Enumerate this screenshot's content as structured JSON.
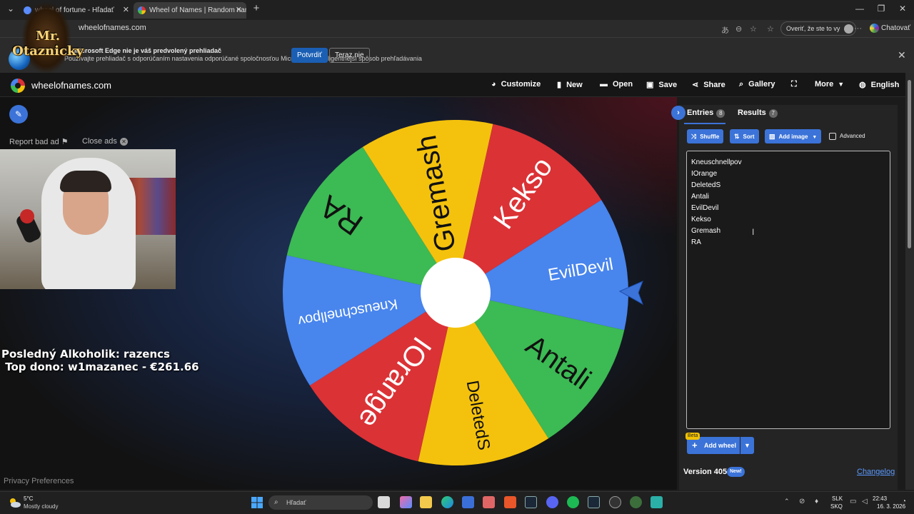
{
  "browser": {
    "tabs": [
      {
        "label": "wheel of fortune - Hľadať",
        "active": false
      },
      {
        "label": "Wheel of Names | Random name pi",
        "active": true
      }
    ],
    "new_tab": "+",
    "url": "wheelofnames.com",
    "verify_label": "Overiť, že ste to vy",
    "chat_label": "Chatovať"
  },
  "notification": {
    "title": "Microsoft Edge nie je váš predvolený prehliadač",
    "body": "Používajte prehliadač s odporúčaním nastavenia odporúčané spoločnosťou Microsoft na inteligentnejší spôsob prehľadávania",
    "confirm": "Potvrdiť",
    "not_now": "Teraz nie"
  },
  "overlay": {
    "logo_text": "Mr. Otaznicky",
    "line1": "Posledný Alkoholik: razencs",
    "line2": " Top dono: w1mazanec - €261.66"
  },
  "header": {
    "brand": "wheelofnames.com",
    "nav": [
      {
        "label": "Customize",
        "icon": "palette-icon"
      },
      {
        "label": "New",
        "icon": "file-icon"
      },
      {
        "label": "Open",
        "icon": "folder-icon"
      },
      {
        "label": "Save",
        "icon": "save-icon"
      },
      {
        "label": "Share",
        "icon": "share-icon"
      },
      {
        "label": "Gallery",
        "icon": "search-icon"
      },
      {
        "label": "",
        "icon": "fullscreen-icon"
      },
      {
        "label": "More",
        "icon": "chevron-down-icon"
      },
      {
        "label": "English",
        "icon": "globe-icon"
      }
    ]
  },
  "ads": {
    "report": "Report bad ad",
    "close": "Close ads",
    "privacy": "Privacy Preferences"
  },
  "wheel": {
    "colors": {
      "red": "#db3236",
      "blue": "#4885ed",
      "green": "#3cba54",
      "yellow": "#f4c20d"
    },
    "segments": [
      {
        "label": "EvilDevil",
        "color": "#4885ed"
      },
      {
        "label": "Antali",
        "color": "#3cba54"
      },
      {
        "label": "DeletedS",
        "color": "#f4c20d"
      },
      {
        "label": "IOrange",
        "color": "#db3236"
      },
      {
        "label": "Kneuschnellpov",
        "color": "#4885ed"
      },
      {
        "label": "RA",
        "color": "#3cba54"
      },
      {
        "label": "Gremash",
        "color": "#f4c20d"
      },
      {
        "label": "Kekso",
        "color": "#db3236"
      }
    ]
  },
  "panel": {
    "tabs": [
      {
        "label": "Entries",
        "count": "8"
      },
      {
        "label": "Results",
        "count": "7"
      }
    ],
    "buttons": {
      "shuffle": "Shuffle",
      "sort": "Sort",
      "add_image": "Add image",
      "advanced": "Advanced"
    },
    "entries": [
      "Kneuschnellpov",
      "IOrange",
      "DeletedS",
      "Antali",
      "EvilDevil",
      "Kekso",
      "Gremash",
      "RA"
    ],
    "beta": "Beta",
    "add_wheel": "Add wheel",
    "version": "Version 405",
    "new_badge": "New!",
    "changelog": "Changelog"
  },
  "taskbar": {
    "weather_temp": "5°C",
    "weather_desc": "Mostly cloudy",
    "search": "Hľadať",
    "lang1": "SLK",
    "lang2": "SKQ",
    "time": "22:43",
    "date": "16. 3. 2026"
  }
}
